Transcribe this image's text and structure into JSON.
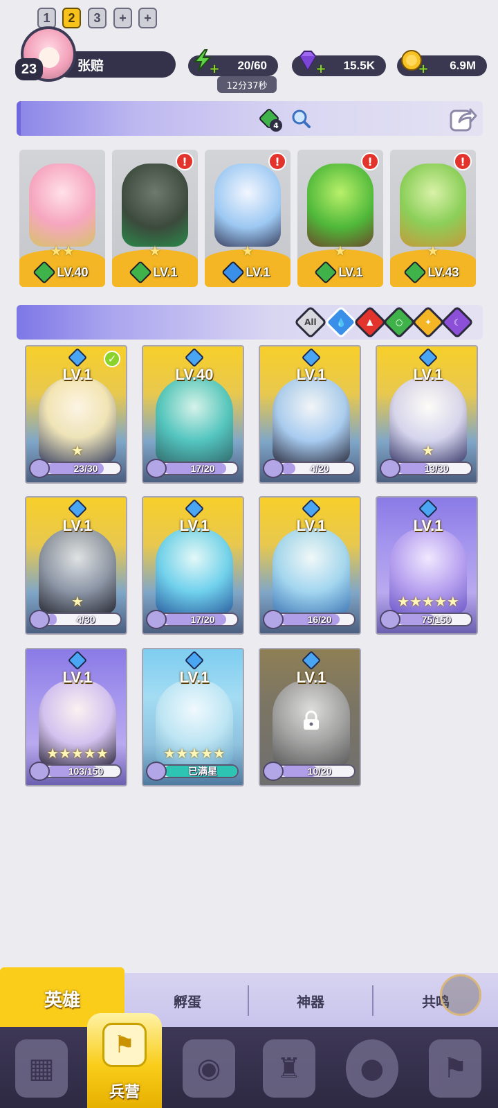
{
  "player": {
    "level": "23",
    "name": "张赔"
  },
  "resources": {
    "energy": "20/60",
    "energy_timer": "12分37秒",
    "gems": "15.5K",
    "gold": "6.9M"
  },
  "team": {
    "tabs": [
      "1",
      "2",
      "3"
    ],
    "active_tab": "2",
    "pet_count": "4",
    "slots": [
      {
        "level": "LV.40",
        "stars": "★★",
        "element": "wind",
        "alert": false
      },
      {
        "level": "LV.1",
        "stars": "★",
        "element": "wind",
        "alert": true
      },
      {
        "level": "LV.1",
        "stars": "★",
        "element": "water",
        "alert": true
      },
      {
        "level": "LV.1",
        "stars": "★",
        "element": "wind",
        "alert": true
      },
      {
        "level": "LV.43",
        "stars": "★",
        "element": "wind",
        "alert": true
      }
    ]
  },
  "filters": {
    "all_label": "All",
    "items": [
      "all",
      "water",
      "fire",
      "wind",
      "light",
      "dark"
    ],
    "active": "water"
  },
  "heroes": [
    {
      "level": "LV.1",
      "shards": "23/30",
      "fill": 0.77,
      "stars": "★",
      "rarity": "gold",
      "selected": true
    },
    {
      "level": "LV.40",
      "shards": "17/20",
      "fill": 0.85,
      "stars": "",
      "rarity": "gold"
    },
    {
      "level": "LV.1",
      "shards": "4/20",
      "fill": 0.2,
      "stars": "",
      "rarity": "gold"
    },
    {
      "level": "LV.1",
      "shards": "13/30",
      "fill": 0.43,
      "stars": "★",
      "rarity": "gold"
    },
    {
      "level": "LV.1",
      "shards": "4/30",
      "fill": 0.13,
      "stars": "★",
      "rarity": "gold"
    },
    {
      "level": "LV.1",
      "shards": "17/20",
      "fill": 0.85,
      "stars": "",
      "rarity": "gold"
    },
    {
      "level": "LV.1",
      "shards": "16/20",
      "fill": 0.8,
      "stars": "",
      "rarity": "gold"
    },
    {
      "level": "LV.1",
      "shards": "75/150",
      "fill": 0.5,
      "stars": "★★★★★",
      "rarity": "purple"
    },
    {
      "level": "LV.1",
      "shards": "103/150",
      "fill": 0.69,
      "stars": "★★★★★",
      "rarity": "purple"
    },
    {
      "level": "LV.1",
      "shards": "已满星",
      "fill": 1,
      "stars": "★★★★★",
      "rarity": "blue",
      "maxed": true
    },
    {
      "level": "LV.1",
      "shards": "10/20",
      "fill": 0.5,
      "stars": "",
      "rarity": "locked",
      "locked": true
    }
  ],
  "tabs": {
    "heroes": "英雄",
    "hatch": "孵蛋",
    "artifacts": "神器",
    "resonance": "共鸣"
  },
  "nav": {
    "barracks": "兵营"
  },
  "colors": {
    "accent": "#f9cd1a",
    "purple_bar": "#7d77e6",
    "nav_bg": "#2d2942"
  }
}
